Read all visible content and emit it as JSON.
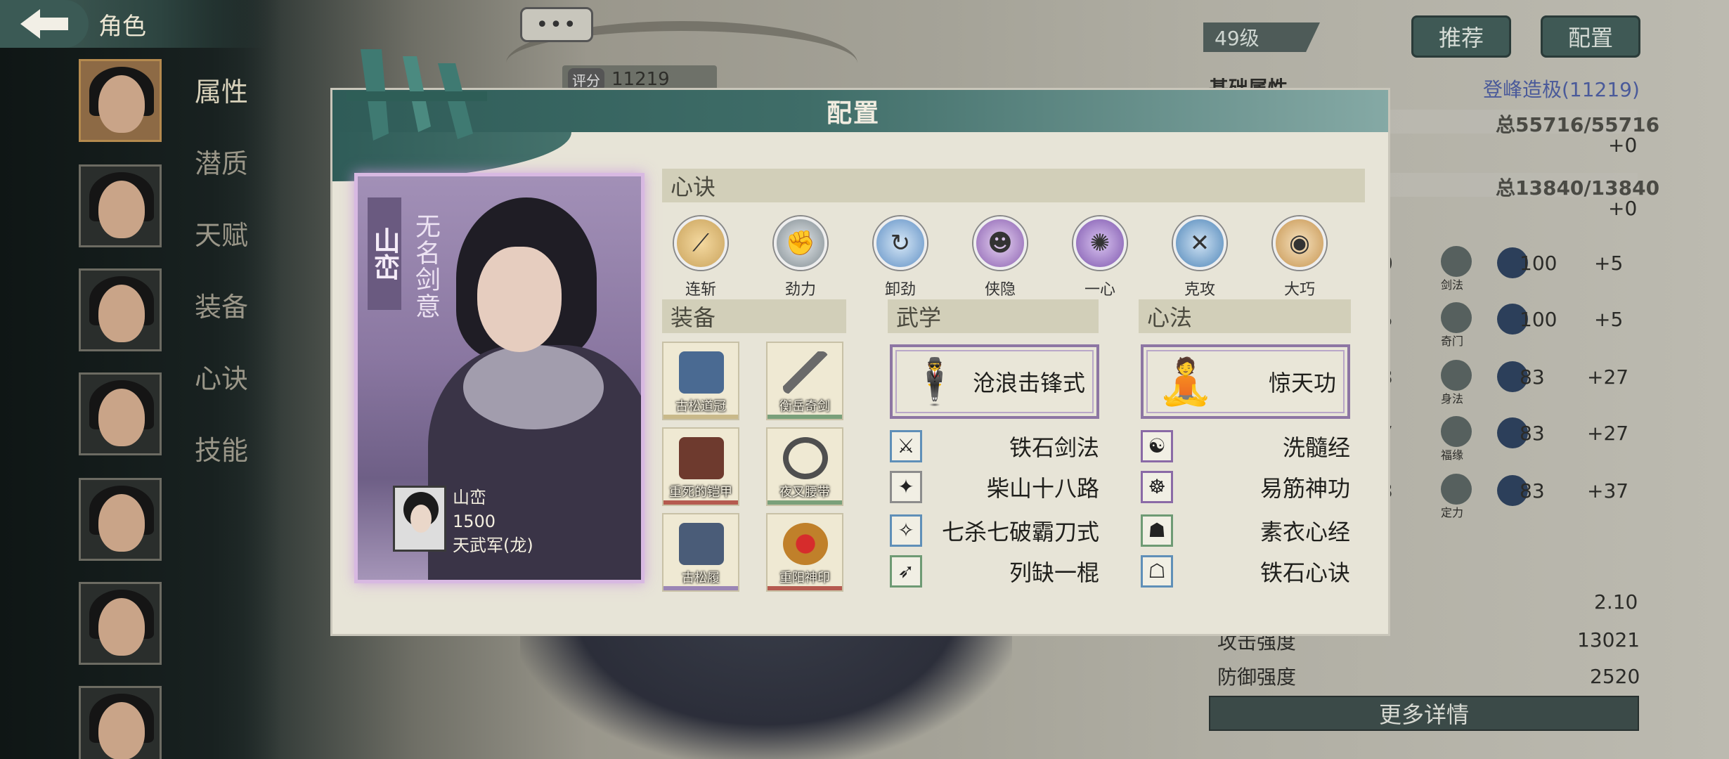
{
  "header": {
    "back_title": "角色"
  },
  "sidebar": {
    "tabs": [
      "属性",
      "潜质",
      "天赋",
      "装备",
      "心诀",
      "技能"
    ]
  },
  "background": {
    "chat_dots": "•••",
    "score_label": "评分",
    "score_value": "11219",
    "level": "49级",
    "recommend_label": "推荐",
    "config_label": "配置",
    "basic_attr_title": "基础属性",
    "rank_text": "登峰造极(11219)",
    "hp_total": "总55716/55716",
    "hp_bonus": "+0",
    "mp_total": "总13840/13840",
    "mp_bonus": "+0",
    "stats": [
      {
        "left": "0",
        "icon_label": "剑法",
        "value": "100",
        "bonus": "+5"
      },
      {
        "left": "5",
        "icon_label": "奇门",
        "value": "100",
        "bonus": "+5"
      },
      {
        "left": "3",
        "icon_label": "身法",
        "value": "83",
        "bonus": "+27"
      },
      {
        "left": "7",
        "icon_label": "福缘",
        "value": "83",
        "bonus": "+27"
      },
      {
        "left": "3",
        "icon_label": "定力",
        "value": "83",
        "bonus": "+37"
      }
    ],
    "extra_rows": [
      {
        "label": "",
        "value": "2.10"
      },
      {
        "label": "攻击强度",
        "value": "13021"
      },
      {
        "label": "防御强度",
        "value": "2520"
      }
    ],
    "more_details": "更多详情"
  },
  "dialog": {
    "title": "配置",
    "character": {
      "vertical_name": "山峦",
      "title": "无名剑意",
      "name": "山峦",
      "power": "1500",
      "faction": "天武军(龙)"
    },
    "xinjue_header": "心诀",
    "xinjue": [
      {
        "label": "连斩",
        "icon": "blades-icon",
        "color": "#c9a25b"
      },
      {
        "label": "劲力",
        "icon": "fist-icon",
        "color": "#7f8a90"
      },
      {
        "label": "卸劲",
        "icon": "swirl-icon",
        "color": "#5f8fc4"
      },
      {
        "label": "侠隐",
        "icon": "mask-icon",
        "color": "#8a5fb0"
      },
      {
        "label": "一心",
        "icon": "flame-icon",
        "color": "#7d55ad"
      },
      {
        "label": "克攻",
        "icon": "cross-swords-icon",
        "color": "#4e85b8"
      },
      {
        "label": "大巧",
        "icon": "eye-icon",
        "color": "#c6944f"
      }
    ],
    "equip_header": "装备",
    "equipment": [
      {
        "name": "古松道冠",
        "color": "#4a6a92",
        "bar": "#c9b98a"
      },
      {
        "name": "衡岳奇剑",
        "color": "#6a6a6a",
        "bar": "#7aa07a"
      },
      {
        "name": "重死的铠甲",
        "color": "#6e3a2e",
        "bar": "#b55a4f"
      },
      {
        "name": "夜叉腰带",
        "color": "#4f4f4f",
        "bar": "#7aa07a"
      },
      {
        "name": "古松履",
        "color": "#4a5c78",
        "bar": "#9b86b5"
      },
      {
        "name": "重阳神印",
        "color": "#c0802a",
        "bar": "#b55a4f"
      }
    ],
    "martial_header": "武学",
    "martial_main": "沧浪击锋式",
    "martial_list": [
      {
        "name": "铁石剑法",
        "frame": "blue",
        "glyph": "⚔"
      },
      {
        "name": "柴山十八路",
        "frame": "gray",
        "glyph": "✦"
      },
      {
        "name": "七杀七破霸刀式",
        "frame": "blue",
        "glyph": "✧"
      },
      {
        "name": "列缺一棍",
        "frame": "green",
        "glyph": "➶"
      }
    ],
    "inner_header": "心法",
    "inner_main": "惊天功",
    "inner_list": [
      {
        "name": "洗髓经",
        "frame": "purple",
        "glyph": "☯"
      },
      {
        "name": "易筋神功",
        "frame": "purple",
        "glyph": "☸"
      },
      {
        "name": "素衣心经",
        "frame": "green",
        "glyph": "☗"
      },
      {
        "name": "铁石心诀",
        "frame": "blue",
        "glyph": "☖"
      }
    ]
  }
}
